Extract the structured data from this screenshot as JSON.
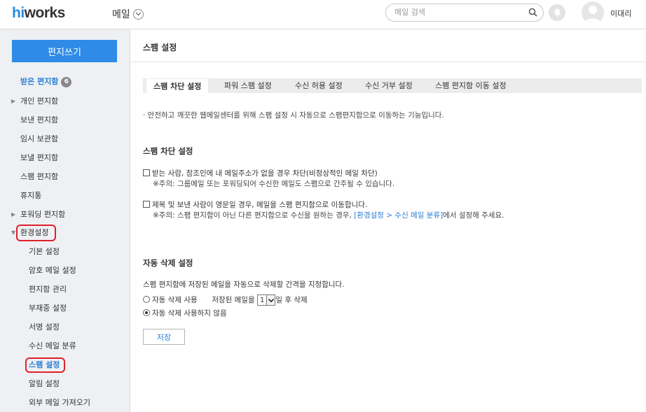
{
  "header": {
    "logo_hi": "hi",
    "logo_rest": "works",
    "app_name": "메일",
    "search_placeholder": "메일 검색",
    "user_name": "이대리"
  },
  "sidebar": {
    "compose_label": "편지쓰기",
    "items": [
      {
        "label": "받은 편지함",
        "badge": "6"
      },
      {
        "label": "개인 편지함"
      },
      {
        "label": "보낸 편지함"
      },
      {
        "label": "임시 보관함"
      },
      {
        "label": "보낼 편지함"
      },
      {
        "label": "스팸 편지함"
      },
      {
        "label": "휴지통"
      },
      {
        "label": "포워딩 편지함"
      },
      {
        "label": "환경설정"
      }
    ],
    "settings_items": [
      {
        "label": "기본 설정"
      },
      {
        "label": "암호 메일 설정"
      },
      {
        "label": "편지함 관리"
      },
      {
        "label": "부재중 설정"
      },
      {
        "label": "서명 설정"
      },
      {
        "label": "수신 메일 분류"
      },
      {
        "label": "스팸 설정"
      },
      {
        "label": "알림 설정"
      },
      {
        "label": "외부 메일 가져오기"
      }
    ]
  },
  "main": {
    "title": "스팸 설정",
    "tabs": [
      {
        "label": "스팸 차단 설정"
      },
      {
        "label": "파워 스팸 설정"
      },
      {
        "label": "수신 허용 설정"
      },
      {
        "label": "수신 거부 설정"
      },
      {
        "label": "스팸 편지함 이동 설정"
      }
    ],
    "intro": "· 안전하고 깨끗한 웹메일센터를 위해 스팸 설정 시 자동으로 스팸편지함으로 이동하는 기능입니다.",
    "block_section": {
      "title": "스팸 차단 설정",
      "option1": "받는 사람, 참조인에 내 메일주소가 없을 경우 차단(비정상적인 메일 차단)",
      "option1_note": "※주의: 그룹메일 또는 포워딩되어 수신한 메일도 스팸으로 간주될 수 있습니다.",
      "option2": "제목 및 보낸 사람이 영문일 경우, 메일을 스팸 편지함으로 이동합니다.",
      "option2_note_pre": "※주의: 스팸 편지함이 아닌 다른 편지함으로 수신을 원하는 경우, ",
      "option2_note_link": "[환경설정 > 수신 메일 분류]",
      "option2_note_post": "에서 설정해 주세요."
    },
    "auto_delete": {
      "title": "자동 삭제 설정",
      "description": "스팸 편지함에 저장된 메일을 자동으로 삭제할 간격을 지정합니다.",
      "use_label": "자동 삭제 사용",
      "stored_pre": "저장된 메일을",
      "days_value": "1",
      "stored_post": "일 후 삭제",
      "not_use_label": "자동 삭제 사용하지 않음"
    },
    "save_label": "저장"
  },
  "colors": {
    "accent": "#2f8be6",
    "link": "#2a7fd4",
    "highlight": "#e0202a",
    "sidebar_bg": "#eef0f3"
  }
}
